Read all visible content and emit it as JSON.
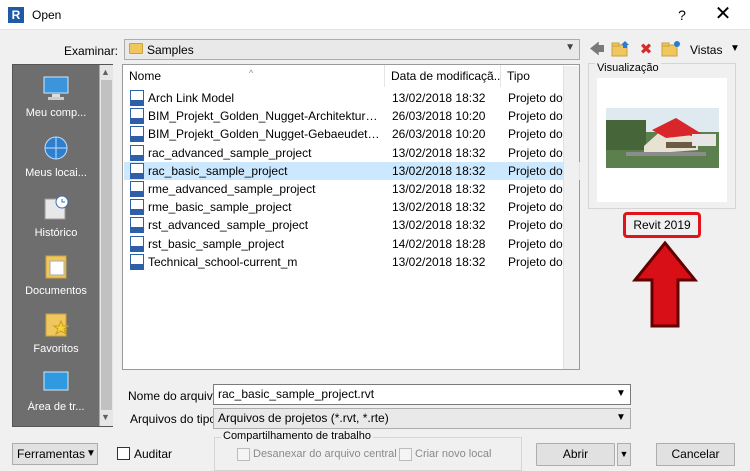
{
  "window": {
    "title": "Open",
    "help": "?",
    "close": "✕",
    "app_icon_letter": "R"
  },
  "lookin": {
    "label": "Examinar:",
    "value": "Samples"
  },
  "toolbar": {
    "views_label": "Vistas"
  },
  "places": [
    {
      "label": "Meu comp...",
      "icon": "computer-icon"
    },
    {
      "label": "Meus locai...",
      "icon": "network-icon"
    },
    {
      "label": "Histórico",
      "icon": "history-icon"
    },
    {
      "label": "Documentos",
      "icon": "documents-icon"
    },
    {
      "label": "Favoritos",
      "icon": "favorites-icon"
    },
    {
      "label": "Área de tr...",
      "icon": "desktop-icon"
    }
  ],
  "filelist": {
    "columns": {
      "name": "Nome",
      "date": "Data de modificaçã...",
      "type": "Tipo"
    },
    "rows": [
      {
        "name": "Arch Link Model",
        "date": "13/02/2018 18:32",
        "type": "Projeto do Aut"
      },
      {
        "name": "BIM_Projekt_Golden_Nugget-Architektur_u...",
        "date": "26/03/2018 10:20",
        "type": "Projeto do Aut"
      },
      {
        "name": "BIM_Projekt_Golden_Nugget-Gebaeudetech...",
        "date": "26/03/2018 10:20",
        "type": "Projeto do Aut"
      },
      {
        "name": "rac_advanced_sample_project",
        "date": "13/02/2018 18:32",
        "type": "Projeto do Aut"
      },
      {
        "name": "rac_basic_sample_project",
        "date": "13/02/2018 18:32",
        "type": "Projeto do Aut",
        "selected": true
      },
      {
        "name": "rme_advanced_sample_project",
        "date": "13/02/2018 18:32",
        "type": "Projeto do Aut"
      },
      {
        "name": "rme_basic_sample_project",
        "date": "13/02/2018 18:32",
        "type": "Projeto do Aut"
      },
      {
        "name": "rst_advanced_sample_project",
        "date": "13/02/2018 18:32",
        "type": "Projeto do Aut"
      },
      {
        "name": "rst_basic_sample_project",
        "date": "14/02/2018 18:28",
        "type": "Projeto do Aut"
      },
      {
        "name": "Technical_school-current_m",
        "date": "13/02/2018 18:32",
        "type": "Projeto do Aut"
      }
    ]
  },
  "preview": {
    "label": "Visualização",
    "version": "Revit 2019"
  },
  "filename": {
    "label": "Nome do arquivo:",
    "value": "rac_basic_sample_project.rvt"
  },
  "filetype": {
    "label": "Arquivos do tipo:",
    "value": "Arquivos de projetos  (*.rvt, *.rte)"
  },
  "buttons": {
    "tools": "Ferramentas",
    "open": "Abrir",
    "cancel": "Cancelar"
  },
  "audit": {
    "label": "Auditar",
    "checked": false
  },
  "worksharing": {
    "title": "Compartilhamento de trabalho",
    "detach": "Desanexar do arquivo central",
    "create_local": "Criar novo local"
  },
  "colors": {
    "selection": "#cce8ff",
    "highlight": "#e0141a",
    "places_bg": "#6e6e6e"
  }
}
